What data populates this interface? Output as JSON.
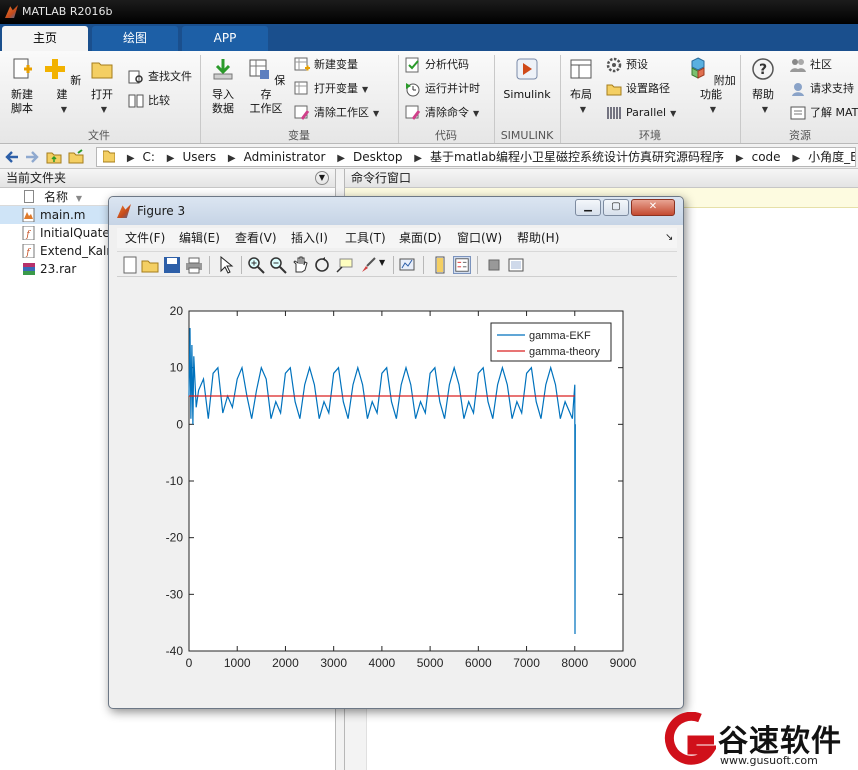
{
  "app": {
    "title": "MATLAB R2016b"
  },
  "tabs": [
    {
      "label": "主页",
      "active": true
    },
    {
      "label": "绘图",
      "active": false
    },
    {
      "label": "APP",
      "active": false
    }
  ],
  "ribbon": {
    "groups": {
      "file": "文件",
      "variable": "变量",
      "code": "代码",
      "simulink": "SIMULINK",
      "environment": "环境",
      "resources": "资源"
    },
    "new_script": "新建\n脚本",
    "new": "新建",
    "open": "打开",
    "find_files": "查找文件",
    "compare": "比较",
    "import_data": "导入\n数据",
    "save_workspace": "保存\n工作区",
    "new_variable": "新建变量",
    "open_variable": "打开变量",
    "clear_workspace": "清除工作区",
    "analyze_code": "分析代码",
    "run_and_time": "运行并计时",
    "clear_commands": "清除命令",
    "simulink": "Simulink",
    "layout": "布局",
    "preferences": "预设",
    "set_path": "设置路径",
    "parallel": "Parallel",
    "addons": "附加功能",
    "help": "帮助",
    "community": "社区",
    "request_support": "请求支持",
    "learn_matlab": "了解 MAT"
  },
  "address": {
    "crumbs": [
      "C:",
      "Users",
      "Administrator",
      "Desktop",
      "基于matlab编程小卫星磁控系统设计仿真研究源码程序",
      "code",
      "小角度_EKF"
    ]
  },
  "current_folder": {
    "title": "当前文件夹",
    "column_name": "名称",
    "files": [
      {
        "name": "main.m",
        "selected": true
      },
      {
        "name": "InitialQuate",
        "selected": false
      },
      {
        "name": "Extend_Kaln",
        "selected": false
      },
      {
        "name": "23.rar",
        "selected": false
      }
    ]
  },
  "command_window": {
    "title": "命令行窗口"
  },
  "figure": {
    "title": "Figure 3",
    "menu": [
      "文件(F)",
      "编辑(E)",
      "查看(V)",
      "插入(I)",
      "工具(T)",
      "桌面(D)",
      "窗口(W)",
      "帮助(H)"
    ]
  },
  "chart_data": {
    "type": "line",
    "xlim": [
      0,
      9000
    ],
    "ylim": [
      -40,
      20
    ],
    "xticks": [
      0,
      1000,
      2000,
      3000,
      4000,
      5000,
      6000,
      7000,
      8000,
      9000
    ],
    "yticks": [
      -40,
      -30,
      -20,
      -10,
      0,
      10,
      20
    ],
    "grid": false,
    "legend_position": "top-right",
    "series": [
      {
        "name": "gamma-EKF",
        "color": "#0072bd",
        "x": [
          0,
          20,
          40,
          60,
          80,
          100,
          150,
          200,
          300,
          400,
          500,
          600,
          700,
          800,
          900,
          1000,
          1100,
          1200,
          1300,
          1400,
          1500,
          1600,
          1700,
          1800,
          1900,
          2000,
          2100,
          2200,
          2300,
          2400,
          2500,
          2600,
          2700,
          2800,
          2900,
          3000,
          3100,
          3200,
          3300,
          3400,
          3500,
          3600,
          3700,
          3800,
          3900,
          4000,
          4100,
          4200,
          4300,
          4400,
          4500,
          4600,
          4700,
          4800,
          4900,
          5000,
          5100,
          5200,
          5300,
          5400,
          5500,
          5600,
          5700,
          5800,
          5900,
          6000,
          6100,
          6200,
          6300,
          6400,
          6500,
          6600,
          6700,
          6800,
          6900,
          7000,
          7100,
          7200,
          7300,
          7400,
          7500,
          7600,
          7700,
          7800,
          7900,
          7950,
          8000,
          8005,
          8010
        ],
        "y": [
          5,
          17,
          1,
          14,
          0,
          12,
          3,
          6,
          8,
          1,
          9,
          10,
          2,
          5,
          3,
          8,
          10,
          5,
          1,
          6,
          10,
          8,
          1,
          4,
          2,
          9,
          10,
          4,
          1,
          7,
          10,
          7,
          1,
          4,
          2,
          9,
          10,
          4,
          1,
          7,
          10,
          7,
          1,
          4,
          2,
          9,
          10,
          4,
          1,
          7,
          10,
          7,
          1,
          4,
          2,
          9,
          10,
          4,
          1,
          7,
          10,
          7,
          1,
          4,
          2,
          9,
          10,
          4,
          1,
          7,
          10,
          7,
          1,
          4,
          2,
          9,
          10,
          4,
          1,
          7,
          10,
          7,
          1,
          4,
          2,
          1,
          7,
          -37,
          0
        ]
      },
      {
        "name": "gamma-theory",
        "color": "#d92020",
        "x": [
          0,
          8000
        ],
        "y": [
          5,
          5
        ]
      }
    ]
  },
  "watermark": {
    "brand": "谷速软件",
    "url": "www.gusuoft.com"
  }
}
